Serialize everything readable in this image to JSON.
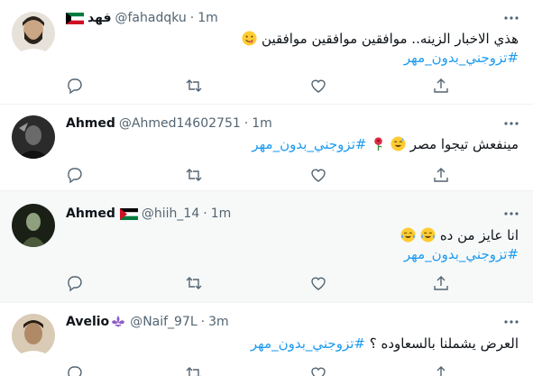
{
  "tweets": [
    {
      "name": "فهد",
      "handle": "@fahadqku",
      "dot": "·",
      "time": "1m",
      "text": "هذي الاخبار الزينه..  موافقين موافقين موافقين",
      "hashtag": "#تزوجني_بدون_مهر",
      "flag": "kuwait",
      "avatar_color": "#c9b79c"
    },
    {
      "name": "Ahmed",
      "handle": "@Ahmed14602751",
      "dot": "·",
      "time": "1m",
      "text": "مينفعش تيجوا مصر",
      "hashtag": "#تزوجني_بدون_مهر",
      "avatar_color": "#1f1f1f"
    },
    {
      "name": "Ahmed",
      "handle": "@hiih_14",
      "dot": "·",
      "time": "1m",
      "text": "انا عايز من ده",
      "hashtag": "#تزوجني_بدون_مهر",
      "flag": "palestine",
      "avatar_color": "#263020"
    },
    {
      "name": "Avelio",
      "handle": "@Naif_97L",
      "dot": "·",
      "time": "3m",
      "text": "العرض يشملنا بالسعاوده ؟",
      "hashtag": "#تزوجني_بدون_مهر",
      "avatar_color": "#b08a66"
    }
  ],
  "colors": {
    "link": "#1d9bf0",
    "secondary": "#536471",
    "divider": "#eff3f4",
    "highlight": "#f7f9f9"
  },
  "icons": [
    "more-icon",
    "reply-icon",
    "retweet-icon",
    "like-icon",
    "share-icon"
  ]
}
